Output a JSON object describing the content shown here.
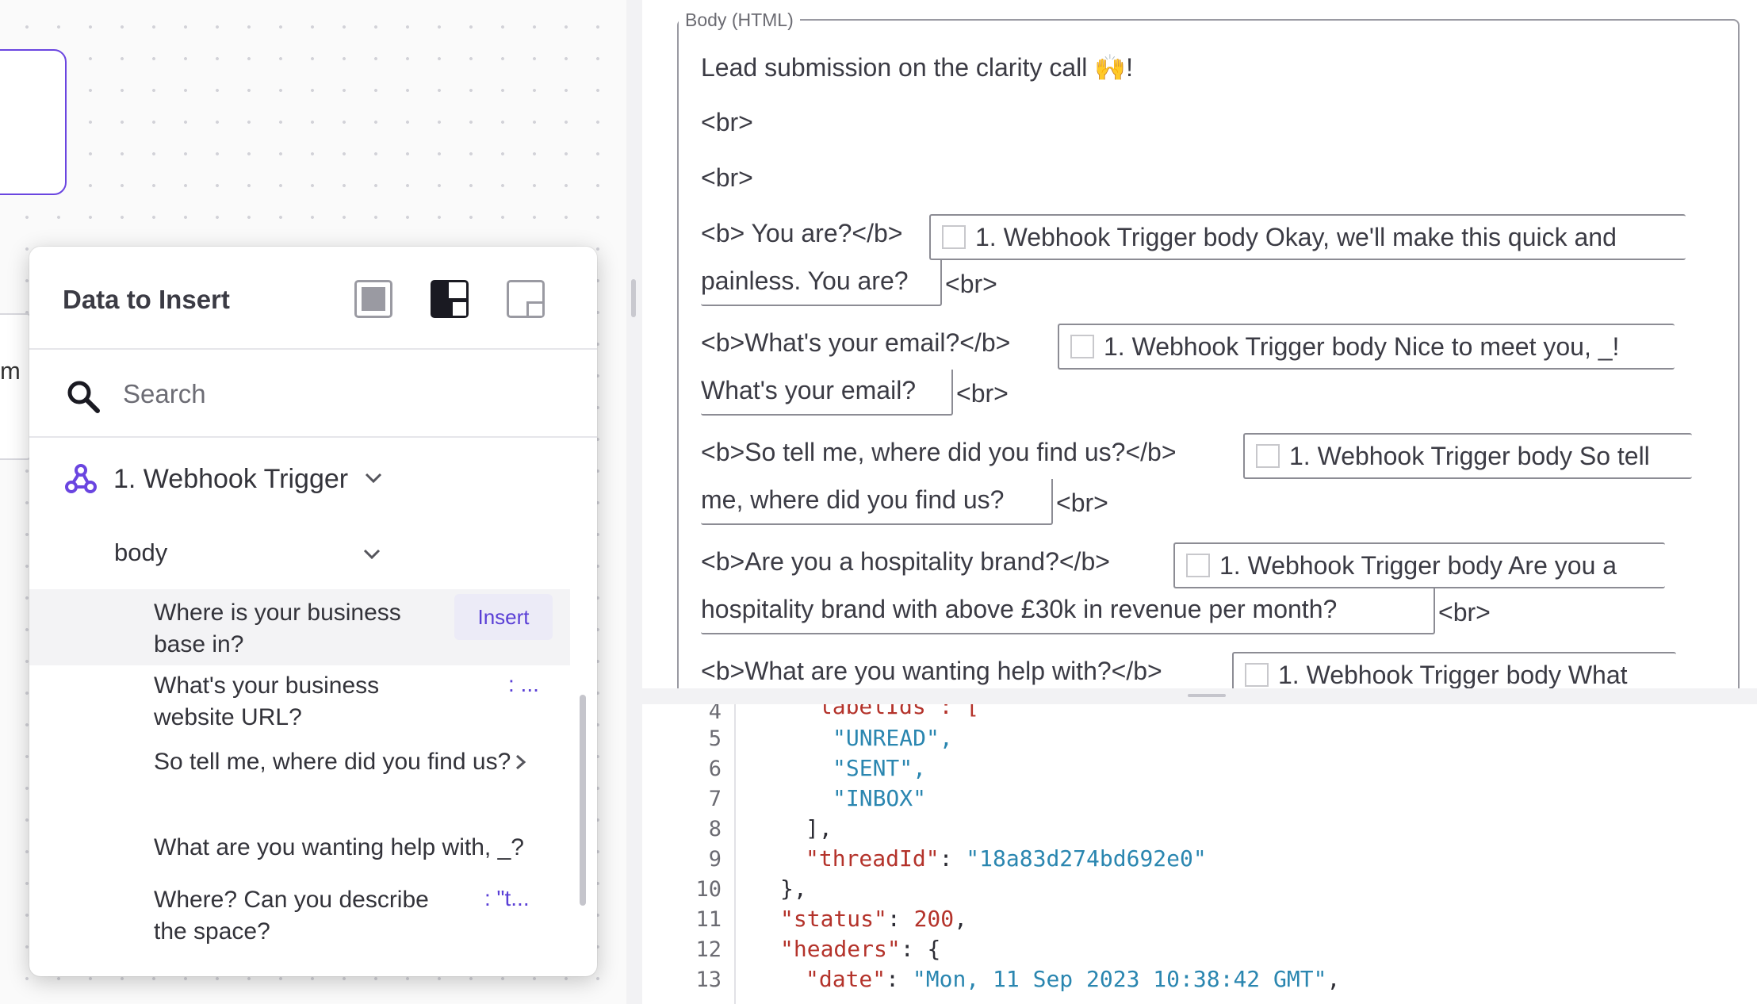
{
  "popup": {
    "title": "Data to Insert",
    "search_placeholder": "Search",
    "trigger_label": "1. Webhook Trigger",
    "body_label": "body",
    "insert_label": "Insert",
    "fields": [
      {
        "label": "Where is your business base in?",
        "value": ""
      },
      {
        "label": "What's your business website URL?",
        "value": ": ..."
      },
      {
        "label": "So tell me, where did you find us?",
        "value": ""
      },
      {
        "label": "What are you wanting help with, _?",
        "value": ""
      },
      {
        "label": "Where? Can you describe the space?",
        "value": ": \"t..."
      }
    ]
  },
  "canvas": {
    "partial_text": "m"
  },
  "editor": {
    "legend": "Body (HTML)",
    "line1": "Lead submission on the clarity call 🙌!",
    "br": "<br>",
    "q1": "<b> You are?</b>",
    "p1a": "1. Webhook Trigger body Okay, we'll make this quick and",
    "p1b": "painless. You are?",
    "q2": "<b>What's your email?</b>",
    "p2a": "1. Webhook Trigger body Nice to meet you, _!",
    "p2b": "What's your email?",
    "q3": "<b>So tell me, where did you find us?</b>",
    "p3a": "1. Webhook Trigger body So tell",
    "p3b": "me, where did you find us?",
    "q4": "<b>Are you a hospitality brand?</b>",
    "p4a": "1. Webhook Trigger body Are you a",
    "p4b": "hospitality brand with above £30k in revenue per month?",
    "q5": "<b>What are you wanting help with?</b>",
    "p5a": "1. Webhook Trigger body What"
  },
  "code": {
    "lines": [
      {
        "n": "4",
        "text": "\"labelIds\": ["
      },
      {
        "n": "5",
        "text": "\"UNREAD\","
      },
      {
        "n": "6",
        "text": "\"SENT\","
      },
      {
        "n": "7",
        "text": "\"INBOX\""
      },
      {
        "n": "8",
        "text": "],"
      },
      {
        "n": "9",
        "key": "\"threadId\"",
        "val": "\"18a83d274bd692e0\""
      },
      {
        "n": "10",
        "text": "},"
      },
      {
        "n": "11",
        "key": "\"status\"",
        "val": "200"
      },
      {
        "n": "12",
        "key": "\"headers\"",
        "val": "{"
      },
      {
        "n": "13",
        "key": "\"date\"",
        "val": "\"Mon, 11 Sep 2023 10:38:42 GMT\""
      }
    ]
  },
  "colors": {
    "accent": "#5a3fd6",
    "node_border": "#6a45e0",
    "json_key": "#b4332b",
    "json_string": "#2a86b0"
  }
}
